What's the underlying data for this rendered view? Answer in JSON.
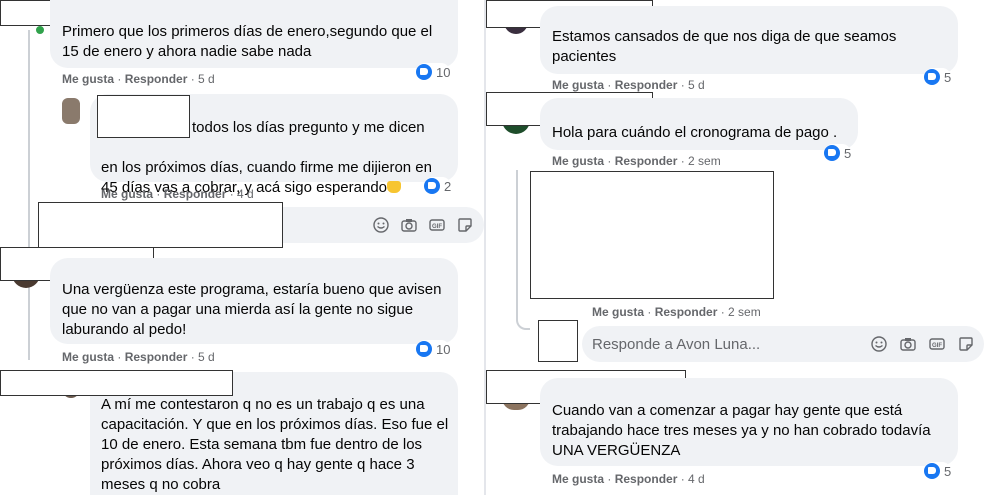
{
  "common": {
    "like": "Me gusta",
    "reply": "Responder"
  },
  "left": {
    "c1": {
      "text": "Primero que los primeros días de enero,segundo que el\n15 de enero y ahora nadie sabe nada",
      "time": "5 d",
      "reactions": "10"
    },
    "c2": {
      "text_first": "todos los días pregunto y me dicen",
      "text_rest": "en los próximos días, cuando firme me dijieron en\n45 días vas a cobrar, y acá sigo esperando",
      "time": "4 d",
      "reactions": "2"
    },
    "c3": {
      "text": "Una vergüenza este programa, estaría bueno que avisen\nque no van a pagar una mierda así la gente no sigue\nlaburando al pedo!",
      "time": "5 d",
      "reactions": "10"
    },
    "c4": {
      "text": "A mí me contestaron q no es un trabajo q es una\ncapacitación. Y que en los próximos días. Eso fue el\n10 de enero. Esta semana tbm fue dentro de los\npróximos días. Ahora veo q hay gente q hace 3\nmeses q no cobra"
    }
  },
  "right": {
    "c1": {
      "text": "Estamos cansados de que nos diga de que seamos\npacientes",
      "time": "5 d",
      "reactions": "5"
    },
    "c2": {
      "text": "Hola para cuándo el cronograma de pago .",
      "time": "2 sem",
      "reactions": "5"
    },
    "c3": {
      "time": "2 sem"
    },
    "input": {
      "placeholder": "Responde a Avon Luna..."
    },
    "c4": {
      "text": "Cuando van a comenzar a pagar hay gente que está\ntrabajando hace tres meses ya y no han cobrado todavía\nUNA VERGÜENZA",
      "time": "4 d",
      "reactions": "5"
    }
  },
  "icons": [
    "emoji-icon",
    "camera-icon",
    "gif-icon",
    "sticker-icon",
    "like-icon"
  ]
}
